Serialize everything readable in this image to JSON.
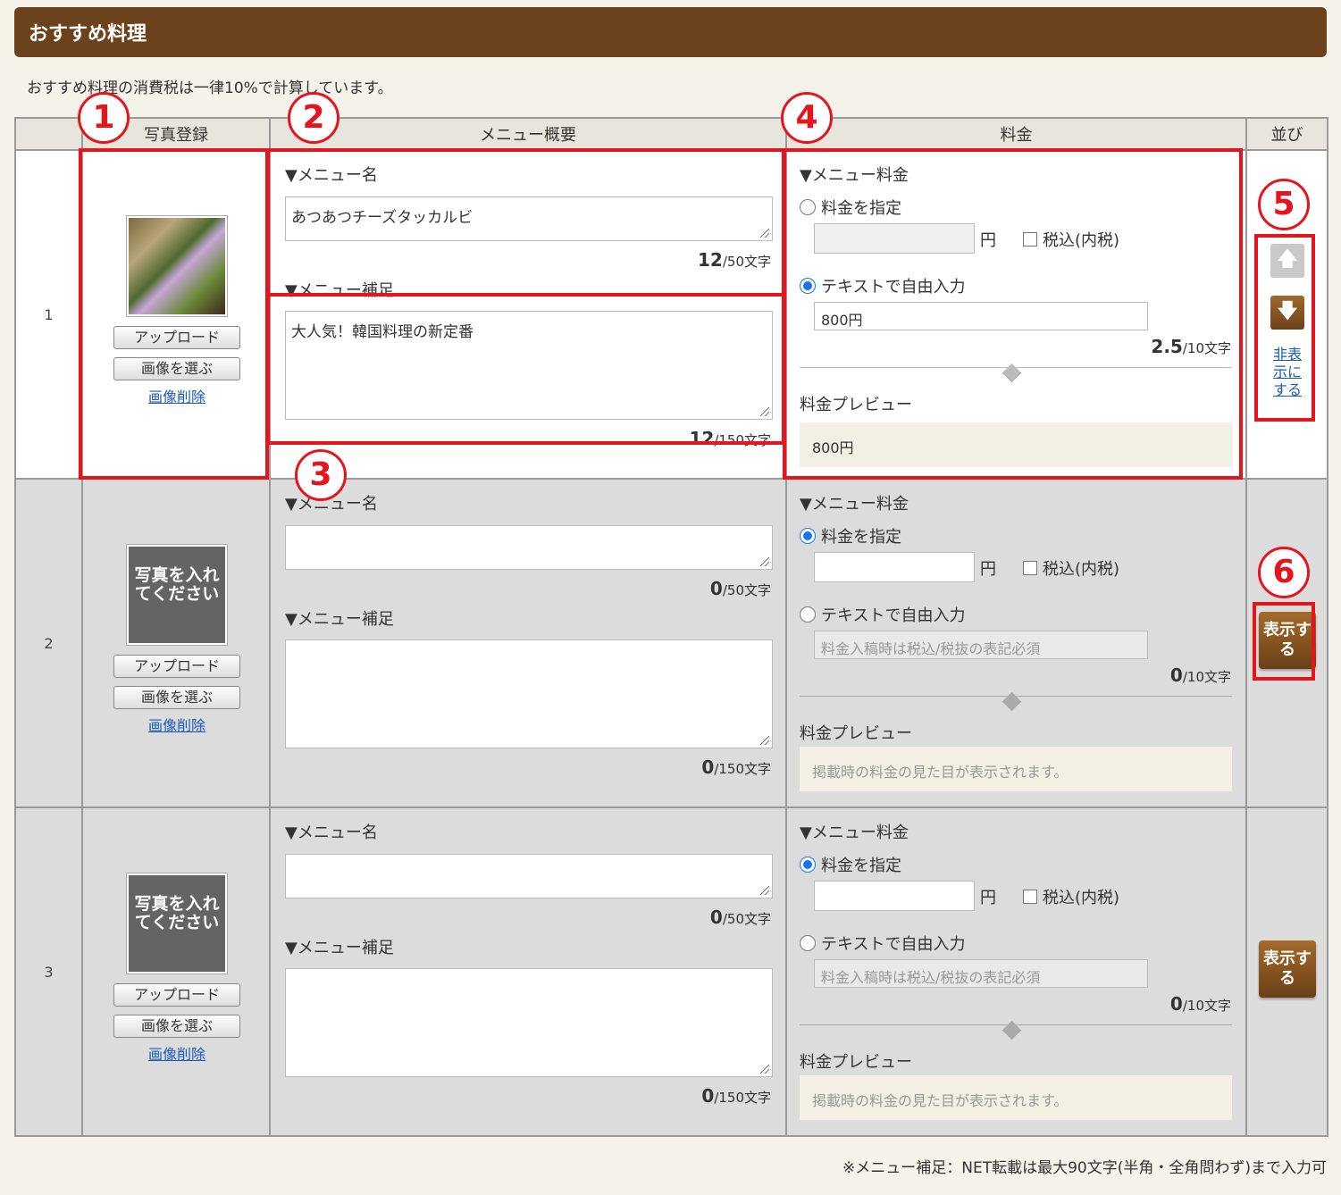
{
  "header": {
    "title": "おすすめ料理"
  },
  "note_top": "おすすめ料理の消費税は一律10%で計算しています。",
  "note_bottom": "※メニュー補足：NET転載は最大90文字(半角・全角問わず)まで入力可",
  "columns": {
    "num": "",
    "photo": "写真登録",
    "menu": "メニュー概要",
    "price": "料金",
    "order": "並び"
  },
  "labels": {
    "menu_name": "▼メニュー名",
    "menu_supplement": "▼メニュー補足",
    "menu_price": "▼メニュー料金",
    "specify_price": "料金を指定",
    "free_text": "テキストで自由入力",
    "yen": "円",
    "tax_included": "税込(内税)",
    "price_preview": "料金プレビュー",
    "upload": "アップロード",
    "choose_image": "画像を選ぶ",
    "delete_image": "画像削除",
    "placeholder_photo": "写真を入れてください",
    "hide": "非表示にする",
    "show": "表示する",
    "up_arrow": "🡅",
    "down_arrow": "🡇"
  },
  "rows": [
    {
      "num": "1",
      "menu_name": "あつあつチーズタッカルビ",
      "menu_name_count": "12",
      "menu_name_max": "/50文字",
      "menu_supplement": "大人気！韓国料理の新定番",
      "menu_supplement_count": "12",
      "menu_supplement_max": "/150文字",
      "price_mode": "free_text",
      "price_value": "",
      "free_text_value": "800円",
      "free_text_placeholder": "",
      "free_count": "2.5",
      "free_max": "/10文字",
      "preview": "800円"
    },
    {
      "num": "2",
      "menu_name": "",
      "menu_name_count": "0",
      "menu_name_max": "/50文字",
      "menu_supplement": "",
      "menu_supplement_count": "0",
      "menu_supplement_max": "/150文字",
      "price_mode": "specify",
      "price_value": "",
      "free_text_value": "",
      "free_text_placeholder": "料金入稿時は税込/税抜の表記必須",
      "free_count": "0",
      "free_max": "/10文字",
      "preview": "掲載時の料金の見た目が表示されます。"
    },
    {
      "num": "3",
      "menu_name": "",
      "menu_name_count": "0",
      "menu_name_max": "/50文字",
      "menu_supplement": "",
      "menu_supplement_count": "0",
      "menu_supplement_max": "/150文字",
      "price_mode": "specify",
      "price_value": "",
      "free_text_value": "",
      "free_text_placeholder": "料金入稿時は税込/税抜の表記必須",
      "free_count": "0",
      "free_max": "/10文字",
      "preview": "掲載時の料金の見た目が表示されます。"
    }
  ],
  "annotations": [
    "1",
    "2",
    "3",
    "4",
    "5",
    "6"
  ],
  "colors": {
    "header_bg": "#6b421b",
    "annotation_red": "#e5141d",
    "link_blue": "#1a5bb5",
    "radio_blue": "#1a73e8"
  }
}
